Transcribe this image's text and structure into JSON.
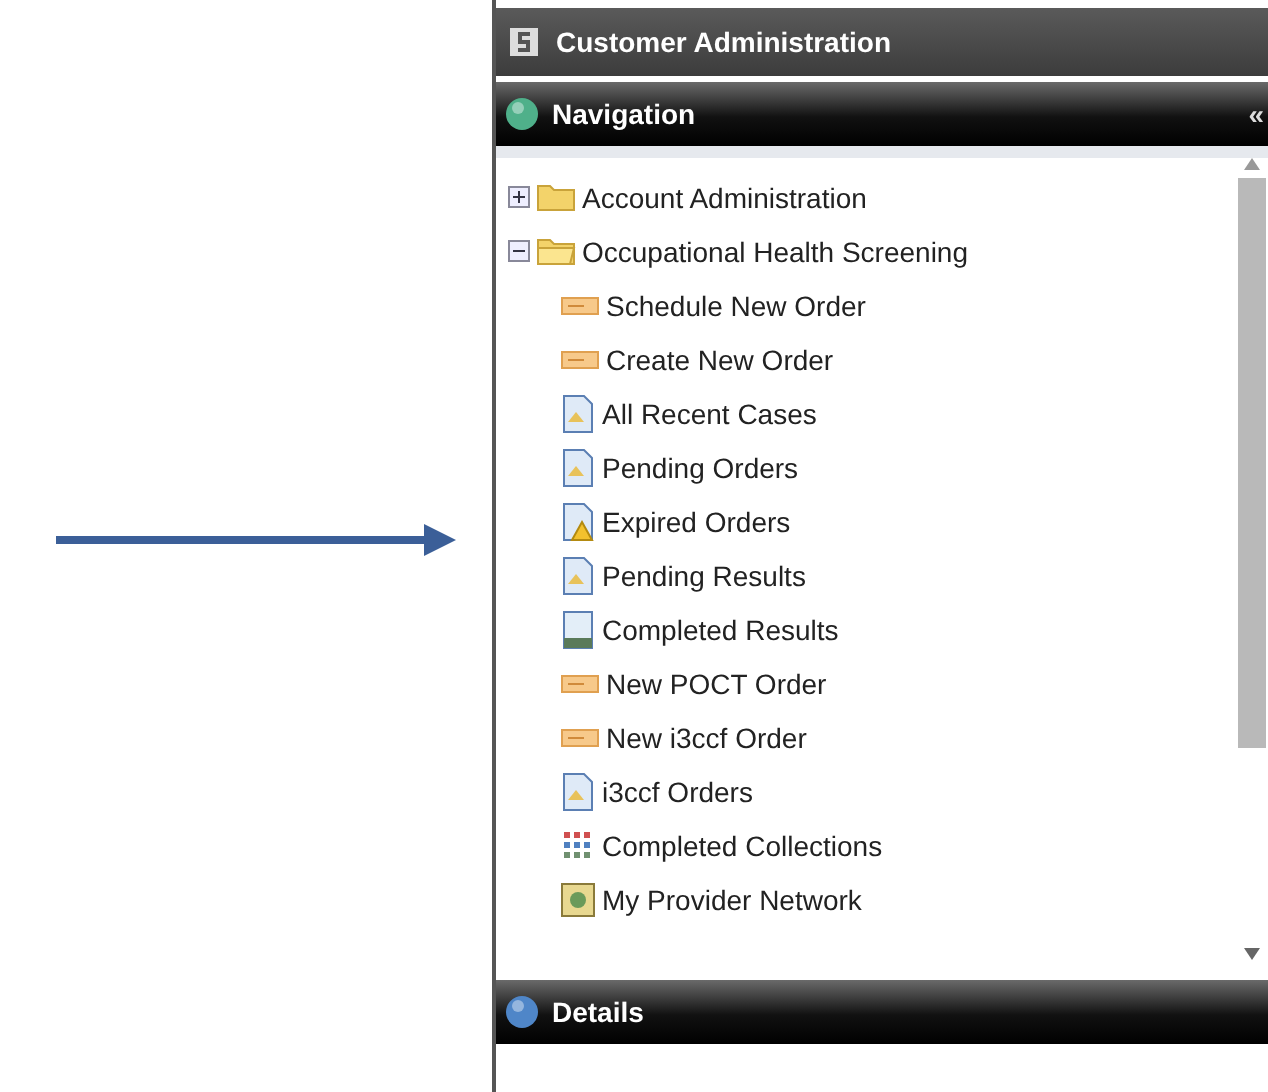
{
  "window": {
    "title": "Customer Administration"
  },
  "navigation": {
    "title": "Navigation",
    "collapse_glyph": "«",
    "tree": [
      {
        "label": "Account Administration",
        "expanded": false
      },
      {
        "label": "Occupational Health Screening",
        "expanded": true,
        "children": [
          {
            "label": "Schedule New Order",
            "kind": "ticket"
          },
          {
            "label": "Create New Order",
            "kind": "ticket"
          },
          {
            "label": "All Recent Cases",
            "kind": "document"
          },
          {
            "label": "Pending Orders",
            "kind": "document"
          },
          {
            "label": "Expired Orders",
            "kind": "warning"
          },
          {
            "label": "Pending Results",
            "kind": "document"
          },
          {
            "label": "Completed Results",
            "kind": "sheet"
          },
          {
            "label": "New POCT Order",
            "kind": "ticket"
          },
          {
            "label": "New i3ccf Order",
            "kind": "ticket"
          },
          {
            "label": "i3ccf Orders",
            "kind": "document"
          },
          {
            "label": "Completed Collections",
            "kind": "grid"
          },
          {
            "label": "My Provider Network",
            "kind": "network"
          }
        ]
      }
    ]
  },
  "details": {
    "title": "Details"
  }
}
